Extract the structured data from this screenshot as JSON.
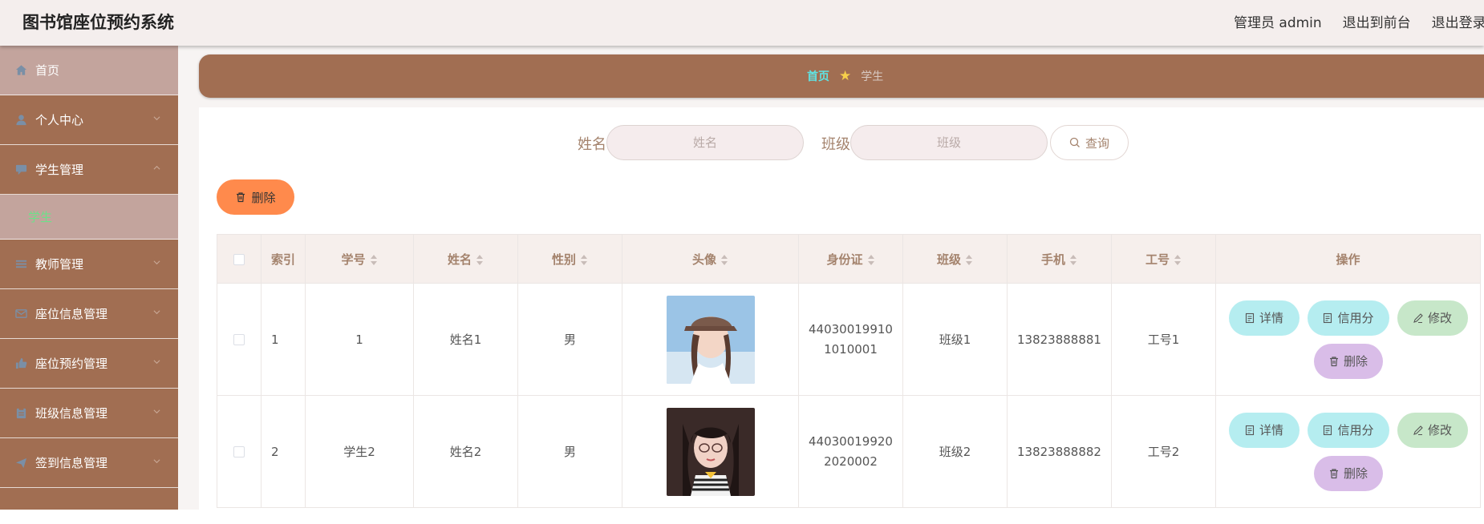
{
  "app": {
    "title": "图书馆座位预约系统"
  },
  "topbar": {
    "links": [
      "管理员 admin",
      "退出到前台",
      "退出登录"
    ]
  },
  "sidebar": {
    "items": [
      {
        "label": "首页",
        "icon": "home-icon"
      },
      {
        "label": "个人中心",
        "icon": "user-icon"
      },
      {
        "label": "学生管理",
        "icon": "chat-icon"
      },
      {
        "label": "教师管理",
        "icon": "list-icon"
      },
      {
        "label": "座位信息管理",
        "icon": "mail-icon"
      },
      {
        "label": "座位预约管理",
        "icon": "thumb-icon"
      },
      {
        "label": "班级信息管理",
        "icon": "clipboard-icon"
      },
      {
        "label": "签到信息管理",
        "icon": "send-icon"
      }
    ],
    "sub_active": "学生"
  },
  "breadcrumb": {
    "home": "首页",
    "current": "学生"
  },
  "search": {
    "name_label": "姓名",
    "name_placeholder": "姓名",
    "class_label": "班级",
    "class_placeholder": "班级",
    "button": "查询"
  },
  "toolbar": {
    "delete": "删除"
  },
  "table": {
    "headers": [
      "索引",
      "学号",
      "姓名",
      "性别",
      "头像",
      "身份证",
      "班级",
      "手机",
      "工号",
      "操作"
    ],
    "rows": [
      {
        "index": "1",
        "student_no": "1",
        "name": "姓名1",
        "gender": "男",
        "id_line1": "44030019910",
        "id_line2": "1010001",
        "class": "班级1",
        "phone": "13823888881",
        "work_no": "工号1"
      },
      {
        "index": "2",
        "student_no": "学生2",
        "name": "姓名2",
        "gender": "男",
        "id_line1": "44030019920",
        "id_line2": "2020002",
        "class": "班级2",
        "phone": "13823888882",
        "work_no": "工号2"
      }
    ],
    "actions": {
      "detail": "详情",
      "credit": "信用分",
      "edit": "修改",
      "delete": "删除"
    }
  },
  "colors": {
    "brand": "#a16e52",
    "active": "#c3a49d",
    "topbar": "#f4eeed",
    "accent_orange": "#ff8a4c",
    "cyan": "#b5edf0",
    "green": "#c7e7c9",
    "purple": "#d9bde8"
  }
}
